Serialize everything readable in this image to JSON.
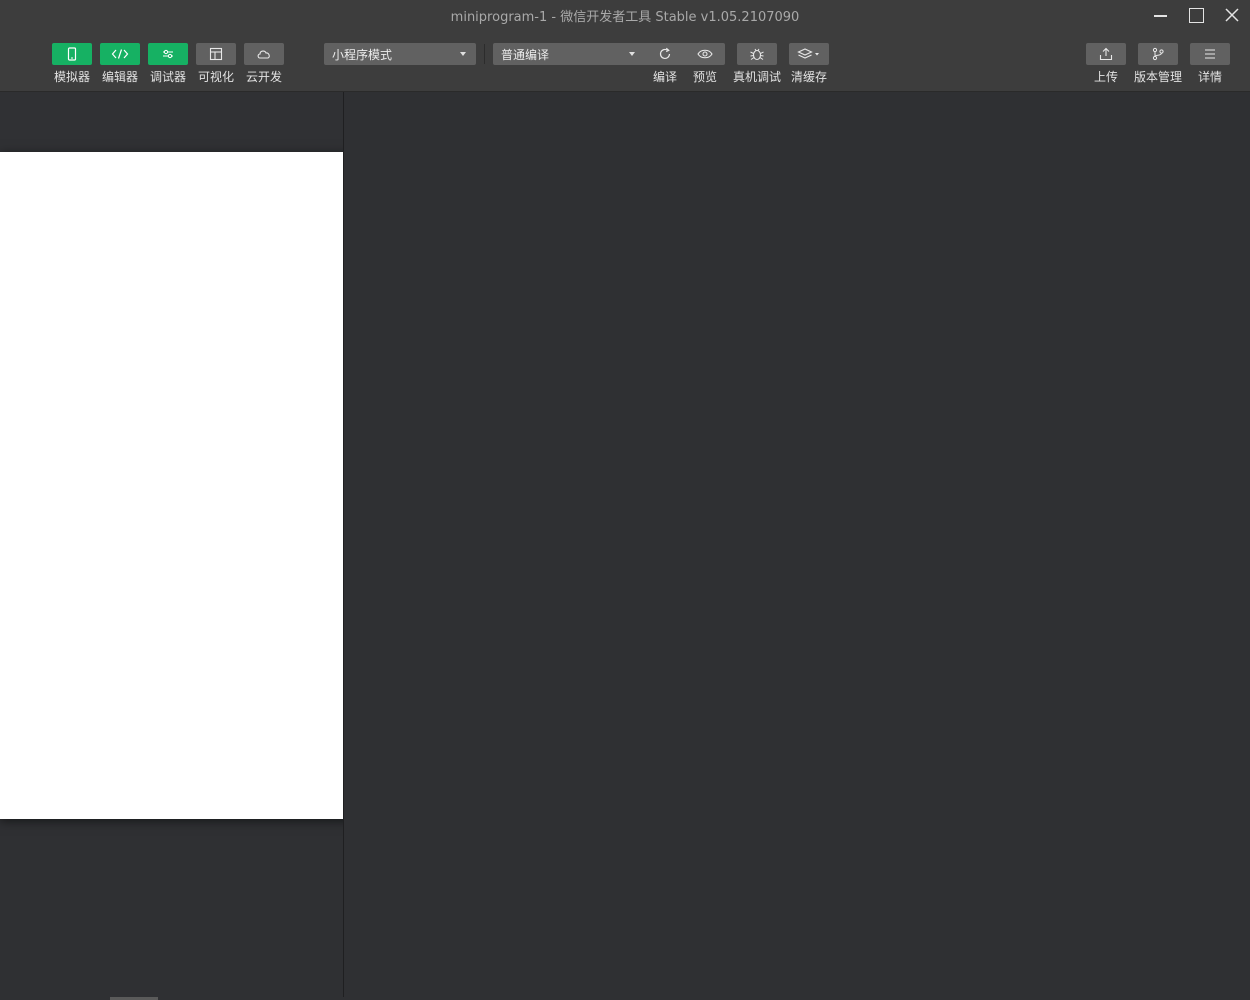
{
  "window": {
    "title": "miniprogram-1 - 微信开发者工具 Stable v1.05.2107090"
  },
  "toolbar": {
    "left_tools": [
      {
        "label": "模拟器",
        "icon": "phone-icon",
        "active": true
      },
      {
        "label": "编辑器",
        "icon": "code-icon",
        "active": true
      },
      {
        "label": "调试器",
        "icon": "debug-sliders-icon",
        "active": true
      },
      {
        "label": "可视化",
        "icon": "layout-icon",
        "active": false
      },
      {
        "label": "云开发",
        "icon": "cloud-icon",
        "active": false
      }
    ],
    "mode_select": {
      "value": "小程序模式"
    },
    "compile_select": {
      "value": "普通编译"
    },
    "actions": [
      {
        "label": "编译",
        "icon": "refresh-icon"
      },
      {
        "label": "预览",
        "icon": "eye-icon"
      },
      {
        "label": "真机调试",
        "icon": "bug-icon"
      },
      {
        "label": "清缓存",
        "icon": "layers-icon"
      }
    ],
    "right_actions": [
      {
        "label": "上传",
        "icon": "upload-icon"
      },
      {
        "label": "版本管理",
        "icon": "branch-icon"
      },
      {
        "label": "详情",
        "icon": "menu-icon"
      }
    ]
  },
  "colors": {
    "accent_green": "#16b163",
    "toolbar_bg": "#3d3d3d",
    "button_gray": "#616161",
    "workspace_bg": "#2f3033",
    "simulator_bg": "#ffffff"
  }
}
